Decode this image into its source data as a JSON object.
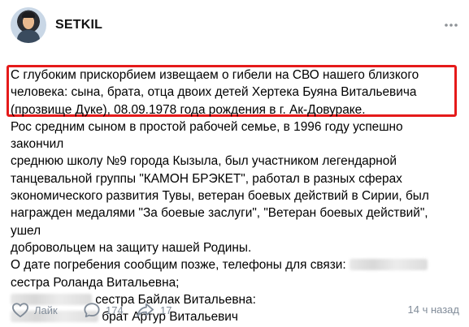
{
  "post": {
    "author": "SETKIL",
    "text": {
      "p1": "С глубоким прискорбием извещаем о гибели на СВО нашего близкого\nчеловека: сына, брата, отца двоих детей Хертека Буяна Витальевича\n(прозвище Дуке), 08.09.1978 года рождения в г. Ак-Довураке.",
      "p2": "Рос средним сыном в простой рабочей семье, в 1996 году успешно закончил\nсреднюю школу №9 города Кызыла, был участником легендарной\nтанцевальной группы \"КАМОН БРЭКЕТ\", работал в разных сферах\nэкономического развития Тувы, ветеран боевых действий в Сирии, был\nнагражден медалями \"За боевые заслуги\", \"Ветеран боевых действий\", ушел\nдобровольцем на защиту нашей Родины.",
      "p3_line1": "О дате погребения сообщим позже, телефоны для связи:",
      "p3_line2": "сестра Роланда Витальевна;",
      "p3_line3": "сестра Байлак Витальевна:",
      "p3_line4": "брат Артур Витальевич"
    }
  },
  "footer": {
    "like_label": "Лайк",
    "comments_count": "174",
    "shares_count": "17",
    "time": "14 ч назад"
  },
  "icons": [
    "more-icon",
    "like-icon",
    "comment-icon",
    "share-icon"
  ],
  "colors": {
    "highlight": "#e51a1a",
    "meta_text": "#818c99"
  }
}
